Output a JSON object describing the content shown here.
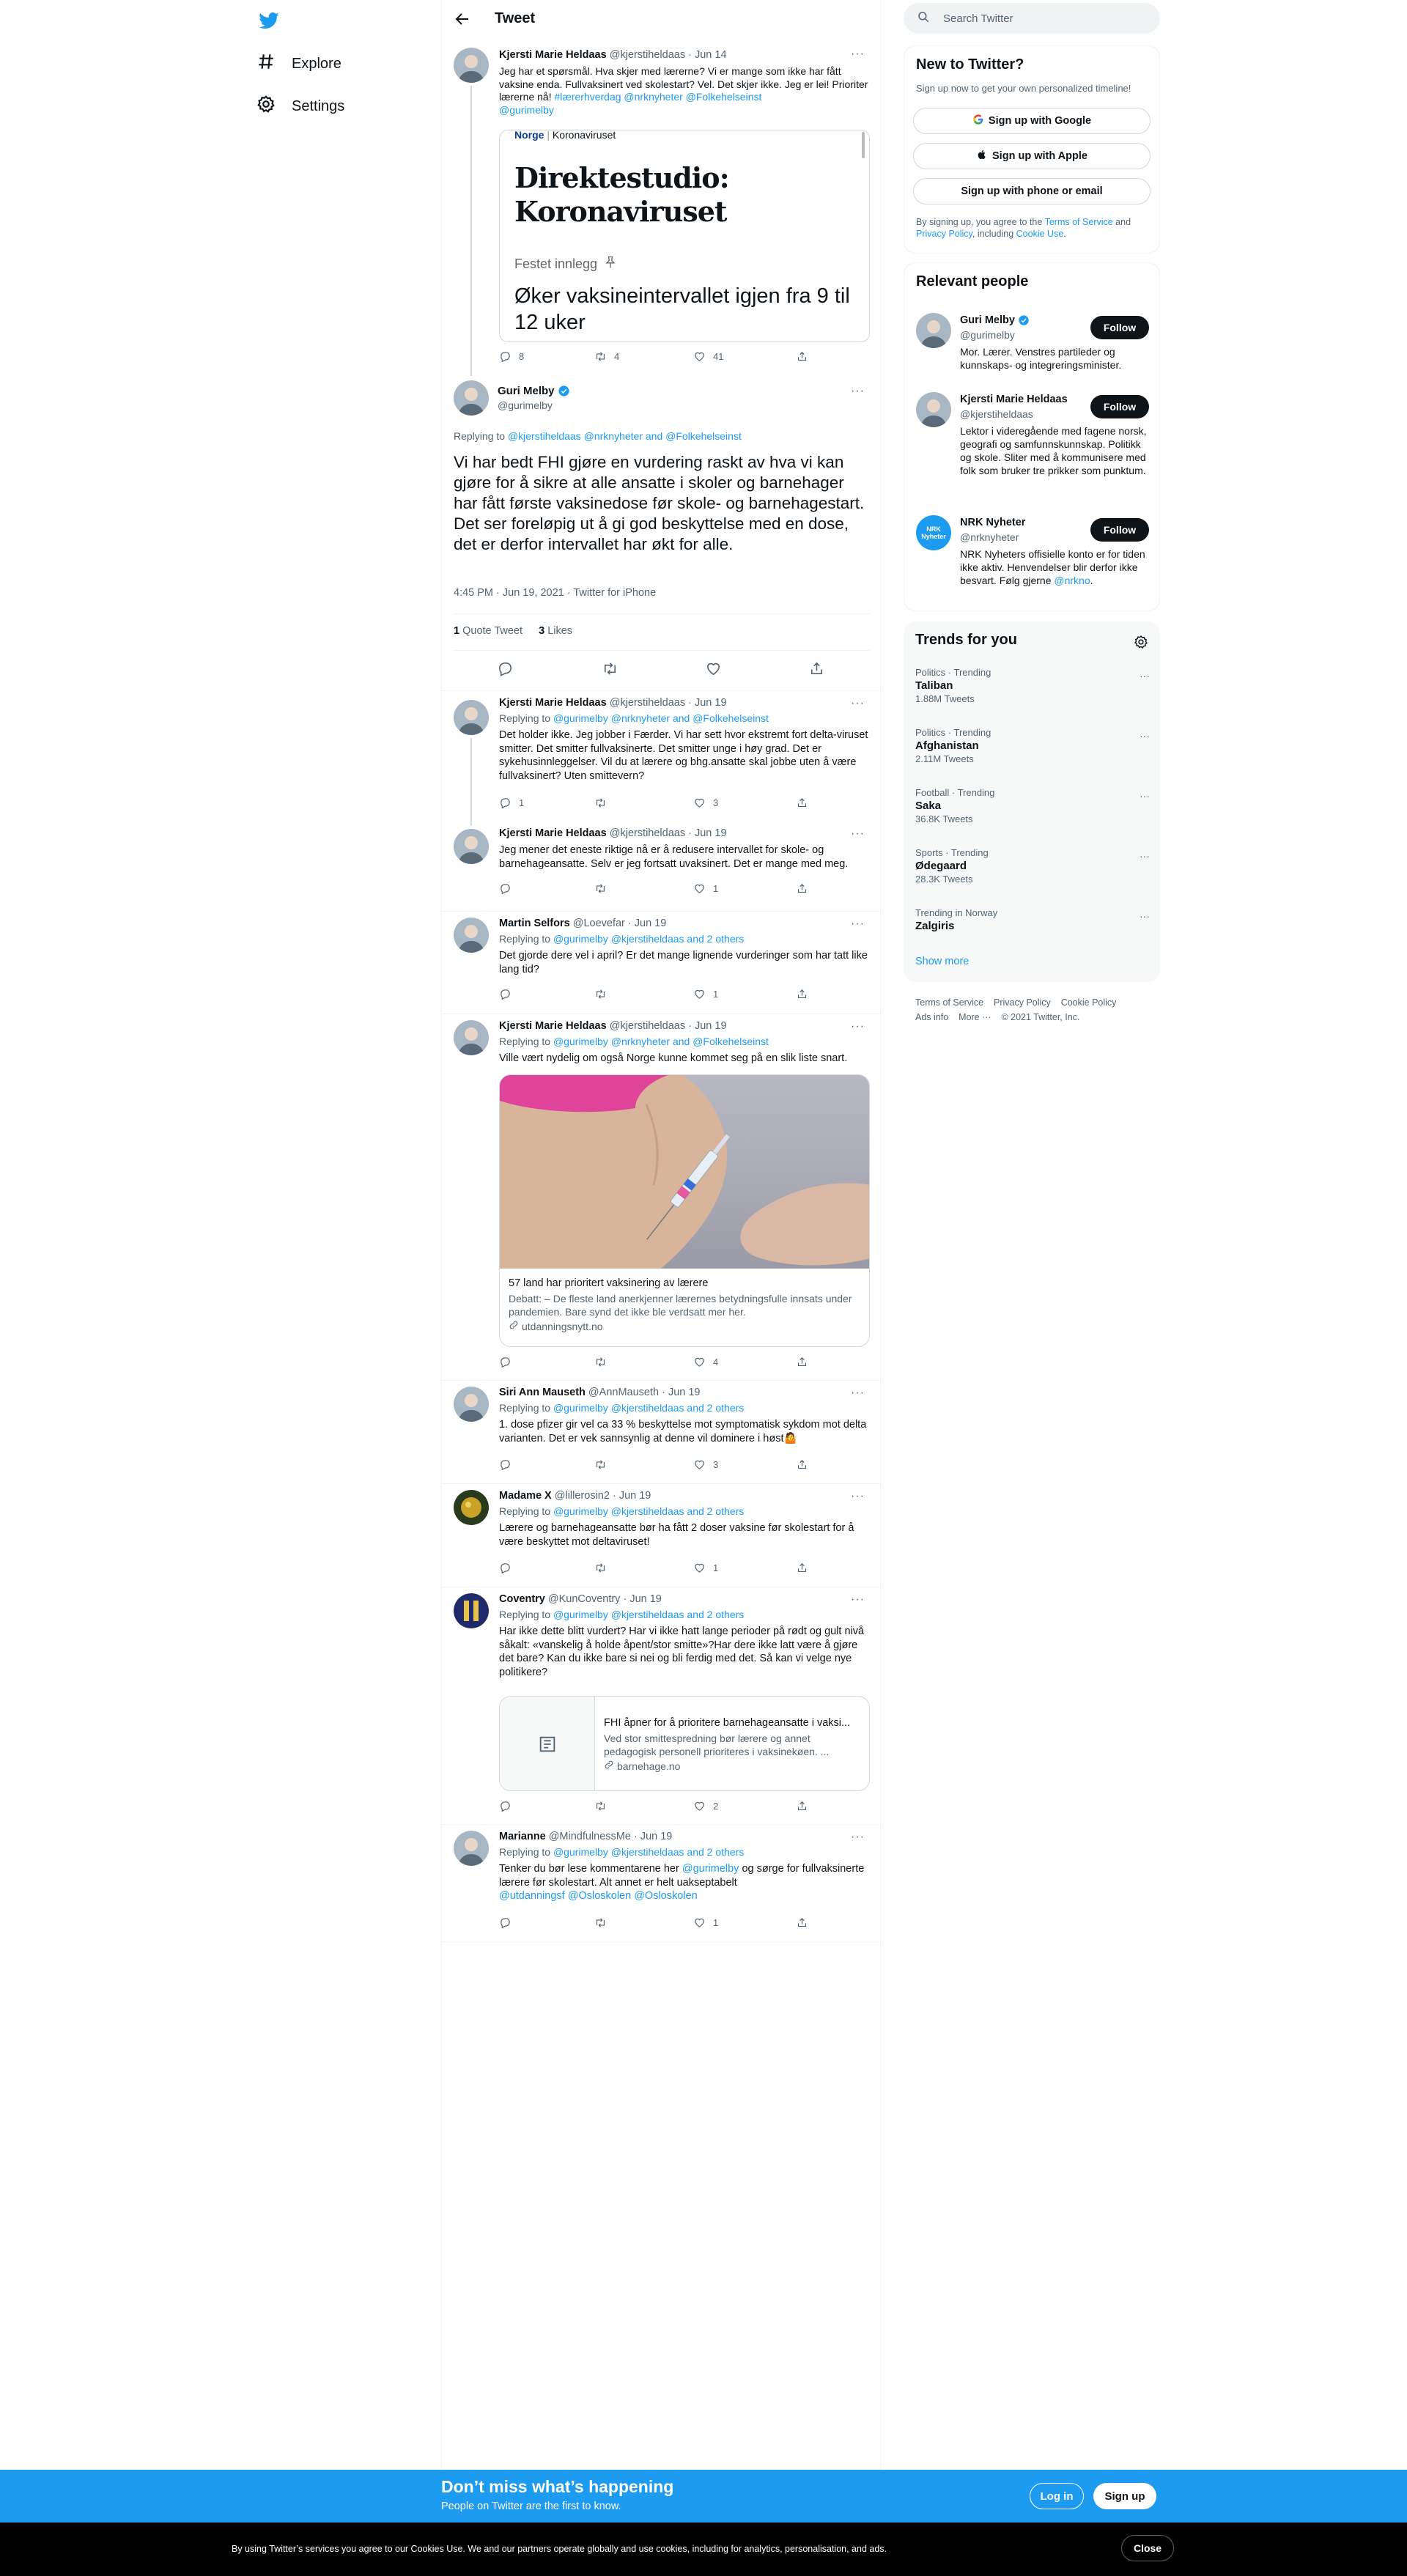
{
  "nav": {
    "explore": "Explore",
    "settings": "Settings"
  },
  "header": {
    "title": "Tweet"
  },
  "parent": {
    "name": "Kjersti Marie Heldaas",
    "handle": "@kjerstiheldaas",
    "date": "· Jun 14",
    "text": "Jeg har et spørsmål. Hva skjer med lærerne? Vi er mange som ikke har fått vaksine enda. Fullvaksinert ved skolestart? Vel. Det skjer ikke. Jeg er lei! Prioriter lærerne nå!",
    "tags": "#lærerhverdag @nrknyheter @Folkehelseinst",
    "tag2": "@gurimelby",
    "card_brand": "Norge",
    "card_section": "Koronaviruset",
    "card_title": "Direktestudio: Koronaviruset",
    "card_pinned": "Festet innlegg",
    "card_headline": "Øker vaksineintervallet igjen fra 9 til 12 uker",
    "replies": "8",
    "retweets": "4",
    "likes": "41"
  },
  "main_tweet": {
    "name": "Guri Melby",
    "handle": "@gurimelby",
    "replying_prefix": "Replying to",
    "replying_to": "@kjerstiheldaas @nrknyheter and @Folkehelseinst",
    "text": "Vi har bedt FHI gjøre en vurdering raskt av hva vi kan gjøre for å sikre at alle ansatte i skoler og barnehager har fått første vaksinedose før skole- og barnehagestart. Det ser foreløpig ut å gi god beskyttelse med en dose, det er derfor intervallet har økt for alle.",
    "meta": "4:45 PM · Jun 19, 2021 · Twitter for iPhone",
    "quote_count": "1",
    "quote_label": "Quote Tweet",
    "likes_count": "3",
    "likes_label": "Likes"
  },
  "replies": [
    {
      "name": "Kjersti Marie Heldaas",
      "handle": "@kjerstiheldaas",
      "date": "· Jun 19",
      "replying": "@gurimelby @nrknyheter and @Folkehelseinst",
      "text": "Det holder ikke. Jeg jobber i Færder. Vi har sett hvor ekstremt fort delta-viruset smitter. Det smitter fullvaksinerte. Det smitter unge i høy grad. Det er sykehusinnleggelser. Vil du at lærere og bhg.ansatte skal jobbe uten å være fullvaksinert? Uten smittevern?",
      "replies": "1",
      "retweets": "",
      "likes": "3"
    },
    {
      "name": "Kjersti Marie Heldaas",
      "handle": "@kjerstiheldaas",
      "date": "· Jun 19",
      "text": "Jeg mener det eneste riktige nå er å redusere intervallet for skole- og barnehageansatte. Selv er jeg fortsatt uvaksinert. Det er mange med meg.",
      "replies": "",
      "retweets": "",
      "likes": "1"
    },
    {
      "name": "Martin Selfors",
      "handle": "@Loevefar",
      "date": "· Jun 19",
      "replying": "@gurimelby @kjerstiheldaas and 2 others",
      "text": "Det gjorde dere vel i april? Er det mange lignende vurderinger som har tatt like lang tid?",
      "replies": "",
      "retweets": "",
      "likes": "1"
    },
    {
      "name": "Kjersti Marie Heldaas",
      "handle": "@kjerstiheldaas",
      "date": "· Jun 19",
      "replying": "@gurimelby @nrknyheter and @Folkehelseinst",
      "text": "Ville vært nydelig om også Norge kunne kommet seg på en slik liste snart.",
      "card_title": "57 land har prioritert vaksinering av lærere",
      "card_desc": "Debatt: – De fleste land anerkjenner lærernes betydningsfulle innsats under pandemien. Bare synd det ikke ble verdsatt mer her.",
      "card_domain": "utdanningsnytt.no",
      "replies": "",
      "retweets": "",
      "likes": "4"
    },
    {
      "name": "Siri Ann Mauseth",
      "handle": "@AnnMauseth",
      "date": "· Jun 19",
      "replying": "@gurimelby @kjerstiheldaas and 2 others",
      "text": "1. dose pfizer gir vel ca 33 % beskyttelse mot symptomatisk sykdom mot delta varianten. Det er vek sannsynlig at denne vil dominere i høst🤷",
      "replies": "",
      "retweets": "",
      "likes": "3"
    },
    {
      "name": "Madame X",
      "handle": "@lillerosin2",
      "date": "· Jun 19",
      "replying": "@gurimelby @kjerstiheldaas and 2 others",
      "text": "Lærere og barnehageansatte bør ha fått 2 doser vaksine før skolestart for å være beskyttet mot deltaviruset!",
      "replies": "",
      "retweets": "",
      "likes": "1"
    },
    {
      "name": "Coventry",
      "handle": "@KunCoventry",
      "date": "· Jun 19",
      "replying": "@gurimelby @kjerstiheldaas and 2 others",
      "text": "Har ikke dette blitt vurdert? Har vi ikke hatt lange perioder på rødt og gult nivå såkalt: «vanskelig å holde åpent/stor smitte»?Har dere ikke latt være å gjøre det bare? Kan du ikke bare si nei og bli ferdig med det. Så kan vi velge nye politikere?",
      "card_title": "FHI åpner for å prioritere barnehageansatte i vaksi...",
      "card_desc": "Ved stor smittespredning bør lærere og annet pedagogisk personell prioriteres i vaksinekøen. ...",
      "card_domain": "barnehage.no",
      "replies": "",
      "retweets": "",
      "likes": "2"
    },
    {
      "name": "Marianne",
      "handle": "@MindfulnessMe",
      "date": "· Jun 19",
      "replying": "@gurimelby @kjerstiheldaas and 2 others",
      "text_a": "Tenker du bør lese kommentarene her",
      "text_mention": "@gurimelby",
      "text_b": "og sørge for fullvaksinerte lærere før skolestart. Alt annet er helt uakseptabelt",
      "text_tags": "@utdanningsf @Osloskolen @Osloskolen",
      "replies": "",
      "retweets": "",
      "likes": "1"
    }
  ],
  "search": {
    "placeholder": "Search Twitter"
  },
  "new_to_twitter": {
    "title": "New to Twitter?",
    "subtitle": "Sign up now to get your own personalized timeline!",
    "google": "Sign up with Google",
    "apple": "Sign up with Apple",
    "phone": "Sign up with phone or email",
    "terms_a": "By signing up, you agree to the",
    "terms_link": "Terms of Service",
    "terms_b": "and",
    "privacy": "Privacy Policy",
    "terms_c": ", including",
    "cookie": "Cookie Use",
    "terms_d": "."
  },
  "relevant": {
    "title": "Relevant people",
    "follow": "Follow",
    "people": [
      {
        "name": "Guri Melby",
        "handle": "@gurimelby",
        "bio": "Mor. Lærer. Venstres partileder og kunnskaps- og integreringsminister."
      },
      {
        "name": "Kjersti Marie Heldaas",
        "handle": "@kjerstiheldaas",
        "bio": "Lektor i videregående med fagene norsk, geografi og samfunnskunnskap. Politikk og skole. Sliter med å kommunisere med folk som bruker tre prikker som punktum."
      },
      {
        "name": "NRK Nyheter",
        "handle": "@nrknyheter",
        "bio": "NRK Nyheters offisielle konto er for tiden ikke aktiv. Henvendelser blir derfor ikke besvart. Følg gjerne",
        "bio_link": "@nrkno",
        "bio_end": ".",
        "avatar_text": "NRK Nyheter"
      }
    ]
  },
  "trends": {
    "title": "Trends for you",
    "items": [
      {
        "cat": "Politics · Trending",
        "name": "Taliban",
        "count": "1.88M Tweets"
      },
      {
        "cat": "Politics · Trending",
        "name": "Afghanistan",
        "count": "2.11M Tweets"
      },
      {
        "cat": "Football · Trending",
        "name": "Saka",
        "count": "36.8K Tweets"
      },
      {
        "cat": "Sports · Trending",
        "name": "Ødegaard",
        "count": "28.3K Tweets"
      },
      {
        "cat": "Trending in Norway",
        "name": "Zalgiris",
        "count": ""
      }
    ],
    "show_more": "Show more"
  },
  "footer": {
    "terms": "Terms of Service",
    "privacy": "Privacy Policy",
    "cookie": "Cookie Policy",
    "ads": "Ads info",
    "more": "More ···",
    "copy": "© 2021 Twitter, Inc."
  },
  "banner": {
    "title": "Don’t miss what’s happening",
    "subtitle": "People on Twitter are the first to know.",
    "login": "Log in",
    "signup": "Sign up"
  },
  "cookie": {
    "text": "By using Twitter’s services you agree to our Cookies Use. We and our partners operate globally and use cookies, including for analytics, personalisation, and ads.",
    "close": "Close"
  },
  "colors": {
    "accent": "#1d9bf0",
    "text": "#0f1419",
    "muted": "#536471"
  }
}
